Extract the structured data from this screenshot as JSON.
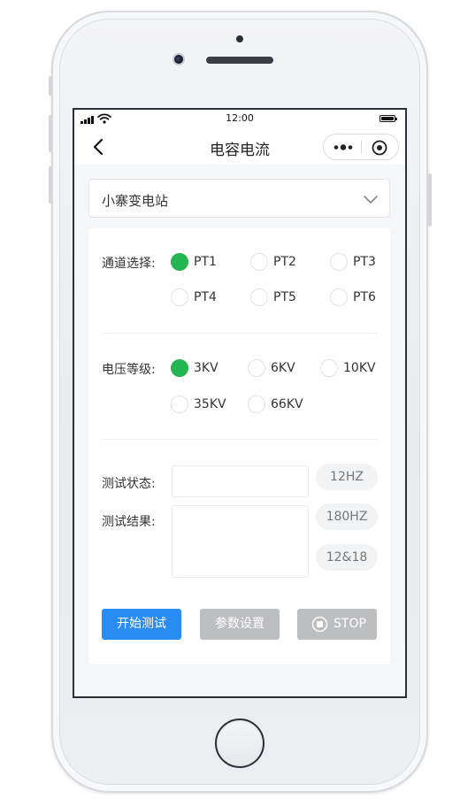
{
  "statusbar": {
    "time": "12:00"
  },
  "navbar": {
    "title": "电容电流"
  },
  "station": {
    "selected": "小寨变电站"
  },
  "channel": {
    "label": "通道选择:",
    "options": [
      "PT1",
      "PT2",
      "PT3",
      "PT4",
      "PT5",
      "PT6"
    ],
    "selected": "PT1"
  },
  "voltage": {
    "label": "电压等级:",
    "options": [
      "3KV",
      "6KV",
      "10KV",
      "35KV",
      "66KV"
    ],
    "selected": "3KV"
  },
  "test": {
    "status_label": "测试状态:",
    "result_label": "测试结果:",
    "status_value": "",
    "result_value": ""
  },
  "freq_buttons": [
    "12HZ",
    "180HZ",
    "12&18"
  ],
  "actions": {
    "start": "开始测试",
    "params": "参数设置",
    "stop": "STOP"
  },
  "colors": {
    "primary": "#2a8cf5",
    "selected_radio": "#27b553",
    "disabled": "#bdbec0"
  }
}
